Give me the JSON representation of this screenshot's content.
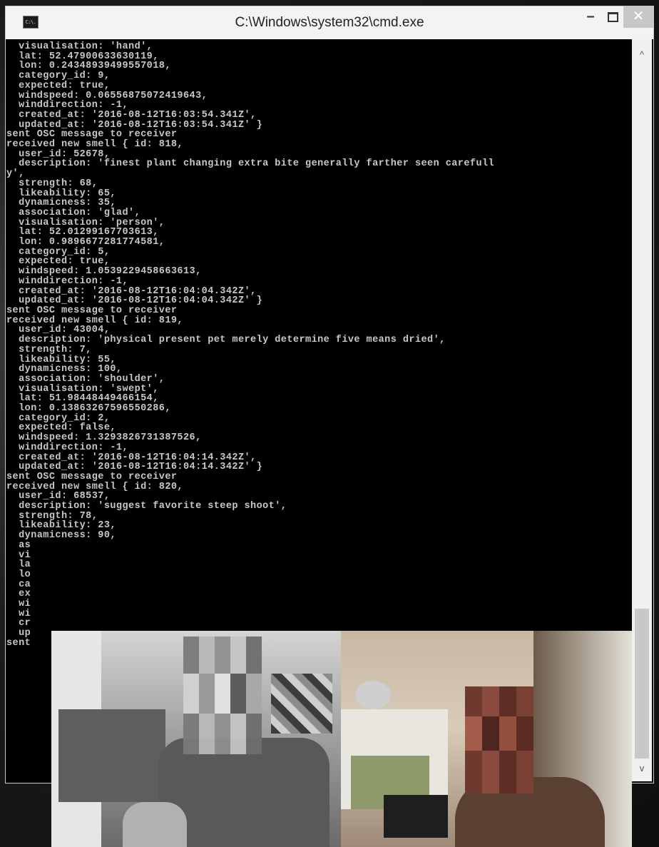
{
  "window": {
    "title": "C:\\Windows\\system32\\cmd.exe",
    "app_icon_label": "C:\\.",
    "controls": {
      "minimize": "–",
      "maximize": "□",
      "close": "✕"
    }
  },
  "console": {
    "lines": [
      "  visualisation: 'hand',",
      "  lat: 52.47900633630119,",
      "  lon: 0.24348939499557018,",
      "  category_id: 9,",
      "  expected: true,",
      "  windspeed: 0.06556875072419643,",
      "  winddirection: -1,",
      "  created_at: '2016-08-12T16:03:54.341Z',",
      "  updated_at: '2016-08-12T16:03:54.341Z' }",
      "sent OSC message to receiver",
      "received new smell { id: 818,",
      "  user_id: 52678,",
      "  description: 'finest plant changing extra bite generally farther seen carefull",
      "y',",
      "  strength: 68,",
      "  likeability: 65,",
      "  dynamicness: 35,",
      "  association: 'glad',",
      "  visualisation: 'person',",
      "  lat: 52.01299167703613,",
      "  lon: 0.9896677281774581,",
      "  category_id: 5,",
      "  expected: true,",
      "  windspeed: 1.0539229458663613,",
      "  winddirection: -1,",
      "  created_at: '2016-08-12T16:04:04.342Z',",
      "  updated_at: '2016-08-12T16:04:04.342Z' }",
      "sent OSC message to receiver",
      "received new smell { id: 819,",
      "  user_id: 43004,",
      "  description: 'physical present pet merely determine five means dried',",
      "  strength: 7,",
      "  likeability: 55,",
      "  dynamicness: 100,",
      "  association: 'shoulder',",
      "  visualisation: 'swept',",
      "  lat: 51.98448449466154,",
      "  lon: 0.13863267596550286,",
      "  category_id: 2,",
      "  expected: false,",
      "  windspeed: 1.3293826731387526,",
      "  winddirection: -1,",
      "  created_at: '2016-08-12T16:04:14.342Z',",
      "  updated_at: '2016-08-12T16:04:14.342Z' }",
      "sent OSC message to receiver",
      "received new smell { id: 820,",
      "  user_id: 68537,",
      "  description: 'suggest favorite steep shoot',",
      "  strength: 78,",
      "  likeability: 23,",
      "  dynamicness: 90,",
      "  as",
      "  vi",
      "  la",
      "  lo",
      "  ca",
      "  ex",
      "  wi",
      "  wi",
      "  cr",
      "  up",
      "sent"
    ]
  },
  "scrollbar": {
    "up_glyph": "^",
    "down_glyph": "v"
  },
  "colors": {
    "console_bg": "#000000",
    "console_text": "#c8c8c8",
    "titlebar_bg": "#f3f3f3",
    "close_button_bg": "#c7c7c7"
  },
  "icons": {
    "app": "cmd-icon",
    "minimize": "minimize-icon",
    "maximize": "maximize-icon",
    "close": "close-icon"
  }
}
